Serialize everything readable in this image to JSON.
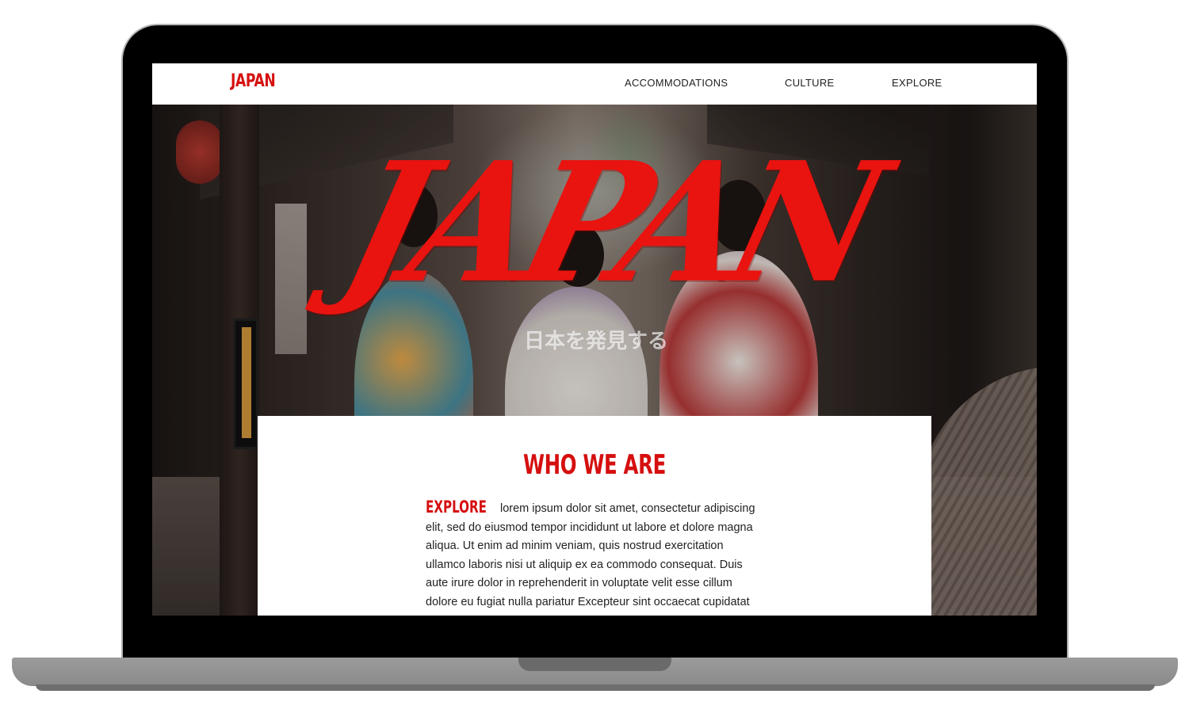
{
  "site": {
    "logo": "JAPAN",
    "nav": [
      "ACCOMMODATIONS",
      "CULTURE",
      "EXPLORE"
    ]
  },
  "hero": {
    "title": "JAPAN",
    "subtitle": "日本を発見する"
  },
  "about": {
    "heading": "WHO WE ARE",
    "lead": "EXPLORE",
    "body": "lorem ipsum dolor sit amet, consectetur adipiscing elit, sed do eiusmod tempor incididunt ut labore et dolore magna aliqua. Ut enim ad minim veniam, quis nostrud exercitation ullamco laboris nisi ut aliquip ex ea commodo consequat. Duis aute irure dolor in reprehenderit in voluptate velit esse cillum dolore eu fugiat nulla pariatur Excepteur sint occaecat cupidatat non proident, sunt in culpa qui officia deserunt mollit anim id est laborum."
  },
  "colors": {
    "brand_red": "#d60f0f",
    "laptop_frame": "#9b9b9b"
  },
  "icons": [
    "laptop-frame"
  ]
}
